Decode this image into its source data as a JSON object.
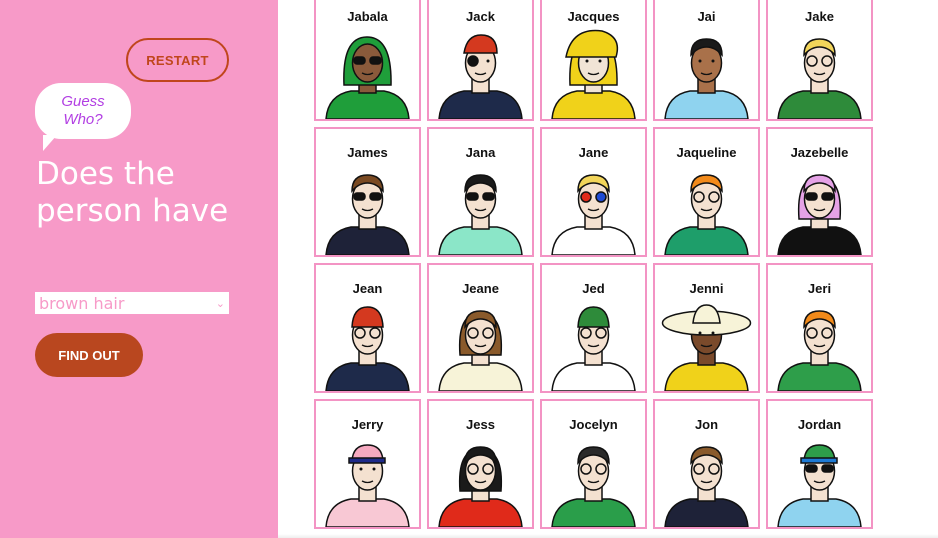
{
  "sidebar": {
    "restart_label": "RESTART",
    "bubble_line1": "Guess",
    "bubble_line2": "Who?",
    "question": "Does the person have",
    "select_value": "brown hair",
    "findout_label": "FIND OUT"
  },
  "colors": {
    "sidebar_bg": "#f79ac8",
    "accent": "#b9471f",
    "card_border": "#f394c4",
    "bubble_text": "#b23fe3"
  },
  "characters": [
    {
      "name": "Jabala",
      "skin": "#8a5a3b",
      "hair": "#1f9e3a",
      "shirt": "#1f9e3a",
      "hat": "scarf",
      "glasses": "sun"
    },
    {
      "name": "Jack",
      "skin": "#f4e1d0",
      "hair": "#d4391f",
      "shirt": "#1e2a4a",
      "hat": "bandana",
      "glasses": "patch"
    },
    {
      "name": "Jacques",
      "skin": "#f1e4d6",
      "hair": "#f0d21a",
      "shirt": "#f0d21a",
      "hat": "rain",
      "glasses": "none"
    },
    {
      "name": "Jai",
      "skin": "#a9714a",
      "hair": "#1a1a1a",
      "shirt": "#8fd3ef",
      "hat": "none",
      "glasses": "none"
    },
    {
      "name": "Jake",
      "skin": "#f4e1d0",
      "hair": "#f2d55a",
      "shirt": "#2e8b3a",
      "hat": "none",
      "glasses": "clear"
    },
    {
      "name": "James",
      "skin": "#f4e1d0",
      "hair": "#7a4a22",
      "shirt": "#1e2238",
      "hat": "none",
      "glasses": "sun"
    },
    {
      "name": "Jana",
      "skin": "#f4e1d0",
      "hair": "#1a1a1a",
      "shirt": "#8be6c8",
      "hat": "none",
      "glasses": "sun"
    },
    {
      "name": "Jane",
      "skin": "#f4e1d0",
      "hair": "#f2d55a",
      "shirt": "#ffffff",
      "hat": "none",
      "glasses": "3d"
    },
    {
      "name": "Jaqueline",
      "skin": "#f4e1d0",
      "hair": "#f28a1a",
      "shirt": "#1e9e6a",
      "hat": "none",
      "glasses": "clear"
    },
    {
      "name": "Jazebelle",
      "skin": "#f4e1d0",
      "hair": "#e5a2e6",
      "shirt": "#111111",
      "hat": "none",
      "glasses": "sun"
    },
    {
      "name": "Jean",
      "skin": "#f4e1d0",
      "hair": "#d4391f",
      "shirt": "#1e2a4a",
      "hat": "beanie",
      "glasses": "clear"
    },
    {
      "name": "Jeane",
      "skin": "#f4e1d0",
      "hair": "#8a5a2b",
      "shirt": "#f7f3d8",
      "hat": "none",
      "glasses": "clear"
    },
    {
      "name": "Jed",
      "skin": "#f4e1d0",
      "hair": "#f28a1a",
      "shirt": "#ffffff",
      "hat": "beanie-green",
      "glasses": "clear"
    },
    {
      "name": "Jenni",
      "skin": "#7a4a2b",
      "hair": "#1a1a1a",
      "shirt": "#f0d21a",
      "hat": "sunhat",
      "glasses": "none"
    },
    {
      "name": "Jeri",
      "skin": "#f4e1d0",
      "hair": "#f28a1a",
      "shirt": "#2e9e4a",
      "hat": "none",
      "glasses": "round"
    },
    {
      "name": "Jerry",
      "skin": "#f4e1d0",
      "hair": "#f2a6b8",
      "shirt": "#f8c8d4",
      "hat": "cap",
      "glasses": "none"
    },
    {
      "name": "Jess",
      "skin": "#f4e1d0",
      "hair": "#1a1a1a",
      "shirt": "#e02a1a",
      "hat": "none",
      "glasses": "clear"
    },
    {
      "name": "Jocelyn",
      "skin": "#f4e1d0",
      "hair": "#2a2a2a",
      "shirt": "#2a9e4a",
      "hat": "none",
      "glasses": "clear"
    },
    {
      "name": "Jon",
      "skin": "#f4e1d0",
      "hair": "#8a5a2b",
      "shirt": "#1e2238",
      "hat": "none",
      "glasses": "clear"
    },
    {
      "name": "Jordan",
      "skin": "#f4e1d0",
      "hair": "#f2d55a",
      "shirt": "#8fd3ef",
      "hat": "cap-green",
      "glasses": "sun"
    }
  ]
}
